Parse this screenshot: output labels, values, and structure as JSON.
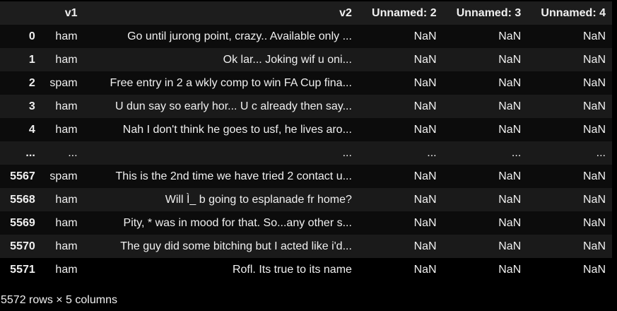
{
  "columns": [
    "",
    "v1",
    "v2",
    "Unnamed: 2",
    "Unnamed: 3",
    "Unnamed: 4"
  ],
  "rows": [
    [
      "0",
      "ham",
      "Go until jurong point, crazy.. Available only ...",
      "NaN",
      "NaN",
      "NaN"
    ],
    [
      "1",
      "ham",
      "Ok lar... Joking wif u oni...",
      "NaN",
      "NaN",
      "NaN"
    ],
    [
      "2",
      "spam",
      "Free entry in 2 a wkly comp to win FA Cup fina...",
      "NaN",
      "NaN",
      "NaN"
    ],
    [
      "3",
      "ham",
      "U dun say so early hor... U c already then say...",
      "NaN",
      "NaN",
      "NaN"
    ],
    [
      "4",
      "ham",
      "Nah I don't think he goes to usf, he lives aro...",
      "NaN",
      "NaN",
      "NaN"
    ],
    [
      "...",
      "...",
      "...",
      "...",
      "...",
      "..."
    ],
    [
      "5567",
      "spam",
      "This is the 2nd time we have tried 2 contact u...",
      "NaN",
      "NaN",
      "NaN"
    ],
    [
      "5568",
      "ham",
      "Will Ì_ b going to esplanade fr home?",
      "NaN",
      "NaN",
      "NaN"
    ],
    [
      "5569",
      "ham",
      "Pity, * was in mood for that. So...any other s...",
      "NaN",
      "NaN",
      "NaN"
    ],
    [
      "5570",
      "ham",
      "The guy did some bitching but I acted like i'd...",
      "NaN",
      "NaN",
      "NaN"
    ],
    [
      "5571",
      "ham",
      "Rofl. Its true to its name",
      "NaN",
      "NaN",
      "NaN"
    ]
  ],
  "caption": "5572 rows × 5 columns"
}
